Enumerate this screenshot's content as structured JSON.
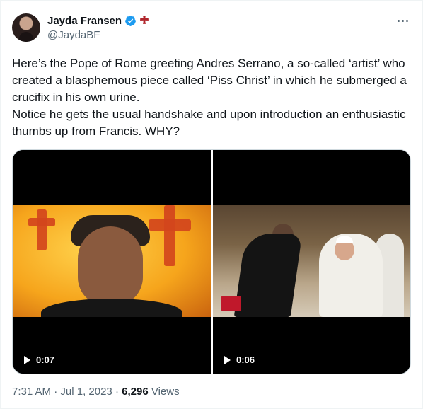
{
  "author": {
    "name": "Jayda Fransen",
    "handle": "@JaydaBF"
  },
  "icons": {
    "verified": "verified-badge-icon",
    "cross": "cross-pattee-icon",
    "more": "more-options-icon",
    "play": "play-icon"
  },
  "colors": {
    "verified": "#1d9bf0",
    "cross": "#b0262c",
    "secondary_text": "#536471",
    "primary_text": "#0f1419"
  },
  "tweet": {
    "paragraph1": "Here’s the Pope of Rome greeting Andres Serrano, a so-called ‘artist’ who created a blasphemous piece called ‘Piss Christ’ in which he submerged a crucifix in his own urine.",
    "paragraph2": "Notice he gets the usual handshake and upon introduction an enthusiastic thumbs up from Francis. WHY?"
  },
  "media": {
    "videos": [
      {
        "duration": "0:07"
      },
      {
        "duration": "0:06"
      }
    ]
  },
  "meta": {
    "time": "7:31 AM",
    "separator1": " · ",
    "date": "Jul 1, 2023",
    "separator2": " · ",
    "views_count": "6,296",
    "views_label": " Views"
  }
}
